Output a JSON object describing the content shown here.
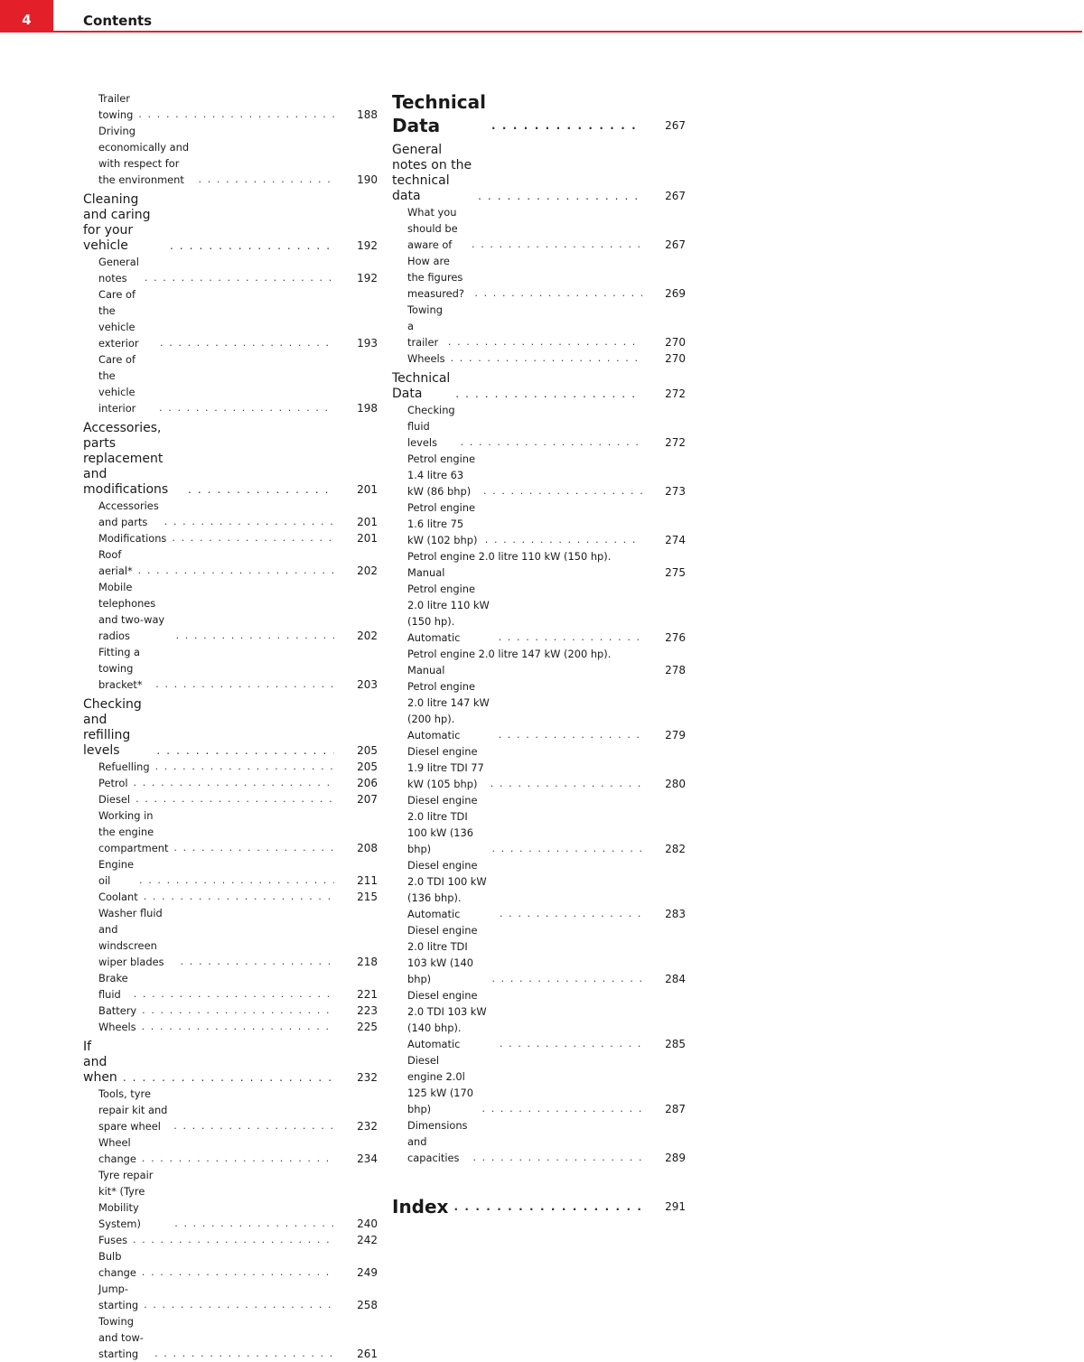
{
  "header": {
    "page_number": "4",
    "title": "Contents",
    "accent_color": "#e3202a"
  },
  "left_column": {
    "entries": [
      {
        "level": 2,
        "text": "Trailer towing",
        "page": "188"
      },
      {
        "level": 2,
        "text": "Driving economically and with respect for the environment",
        "page": "190"
      },
      {
        "level": 1,
        "text": "Cleaning and caring for your vehicle",
        "page": "192"
      },
      {
        "level": 2,
        "text": "General notes",
        "page": "192"
      },
      {
        "level": 2,
        "text": "Care of the vehicle exterior",
        "page": "193"
      },
      {
        "level": 2,
        "text": "Care of the vehicle interior",
        "page": "198"
      },
      {
        "level": 1,
        "text": "Accessories, parts replacement and modifications",
        "page": "201"
      },
      {
        "level": 2,
        "text": "Accessories and parts",
        "page": "201"
      },
      {
        "level": 2,
        "text": "Modifications",
        "page": "201"
      },
      {
        "level": 2,
        "text": "Roof aerial*",
        "page": "202"
      },
      {
        "level": 2,
        "text": "Mobile telephones and two-way radios",
        "page": "202"
      },
      {
        "level": 2,
        "text": "Fitting a towing bracket*",
        "page": "203"
      },
      {
        "level": 1,
        "text": "Checking and refilling levels",
        "page": "205"
      },
      {
        "level": 2,
        "text": "Refuelling",
        "page": "205"
      },
      {
        "level": 2,
        "text": "Petrol",
        "page": "206"
      },
      {
        "level": 2,
        "text": "Diesel",
        "page": "207"
      },
      {
        "level": 2,
        "text": "Working in the engine compartment",
        "page": "208"
      },
      {
        "level": 2,
        "text": "Engine oil",
        "page": "211"
      },
      {
        "level": 2,
        "text": "Coolant",
        "page": "215"
      },
      {
        "level": 2,
        "text": "Washer fluid and windscreen wiper blades",
        "page": "218"
      },
      {
        "level": 2,
        "text": "Brake fluid",
        "page": "221"
      },
      {
        "level": 2,
        "text": "Battery",
        "page": "223"
      },
      {
        "level": 2,
        "text": "Wheels",
        "page": "225"
      },
      {
        "level": 1,
        "text": "If and when",
        "page": "232"
      },
      {
        "level": 2,
        "text": "Tools, tyre repair kit and spare wheel",
        "page": "232"
      },
      {
        "level": 2,
        "text": "Wheel change",
        "page": "234"
      },
      {
        "level": 2,
        "text": "Tyre repair kit* (Tyre Mobility System)",
        "page": "240"
      },
      {
        "level": 2,
        "text": "Fuses",
        "page": "242"
      },
      {
        "level": 2,
        "text": "Bulb change",
        "page": "249"
      },
      {
        "level": 2,
        "text": "Jump-starting",
        "page": "258"
      },
      {
        "level": 2,
        "text": "Towing and tow-starting",
        "page": "261"
      }
    ]
  },
  "right_column": {
    "entries": [
      {
        "level": 0,
        "text": "Technical Data",
        "page": "267"
      },
      {
        "level": 1,
        "text": "General notes on the technical data",
        "page": "267"
      },
      {
        "level": 2,
        "text": "What you should be aware of",
        "page": "267"
      },
      {
        "level": 2,
        "text": "How are the figures measured?",
        "page": "269"
      },
      {
        "level": 2,
        "text": "Towing a trailer",
        "page": "270"
      },
      {
        "level": 2,
        "text": "Wheels",
        "page": "270"
      },
      {
        "level": 1,
        "text": "Technical Data",
        "page": "272"
      },
      {
        "level": 2,
        "text": "Checking fluid levels",
        "page": "272"
      },
      {
        "level": 2,
        "text": "Petrol engine 1.4 litre 63 kW (86 bhp)",
        "page": "273"
      },
      {
        "level": 2,
        "text": "Petrol engine 1.6 litre 75 kW (102 bhp)",
        "page": "274"
      },
      {
        "level": 2,
        "text": "Petrol engine 2.0 litre 110 kW (150 hp). Manual",
        "page": "275"
      },
      {
        "level": 2,
        "text": "Petrol engine 2.0 litre 110 kW (150 hp). Automatic",
        "page": "276"
      },
      {
        "level": 2,
        "text": "Petrol engine 2.0 litre 147 kW (200 hp). Manual",
        "page": "278"
      },
      {
        "level": 2,
        "text": "Petrol engine 2.0 litre 147 kW (200 hp). Automatic",
        "page": "279"
      },
      {
        "level": 2,
        "text": "Diesel engine 1.9 litre TDI 77 kW (105 bhp)",
        "page": "280"
      },
      {
        "level": 2,
        "text": "Diesel engine 2.0 litre TDI 100 kW (136 bhp)",
        "page": "282"
      },
      {
        "level": 2,
        "text": "Diesel engine 2.0 TDI 100 kW (136 bhp). Automatic",
        "page": "283"
      },
      {
        "level": 2,
        "text": "Diesel engine 2.0 litre TDI 103 kW (140 bhp)",
        "page": "284"
      },
      {
        "level": 2,
        "text": "Diesel engine 2.0 TDI 103 kW (140 bhp). Automatic",
        "page": "285"
      },
      {
        "level": 2,
        "text": "Diesel engine 2.0l 125 kW (170 bhp)",
        "page": "287"
      },
      {
        "level": 2,
        "text": "Dimensions and capacities",
        "page": "289"
      },
      {
        "level": 0,
        "text": "Index",
        "page": "291"
      }
    ]
  }
}
